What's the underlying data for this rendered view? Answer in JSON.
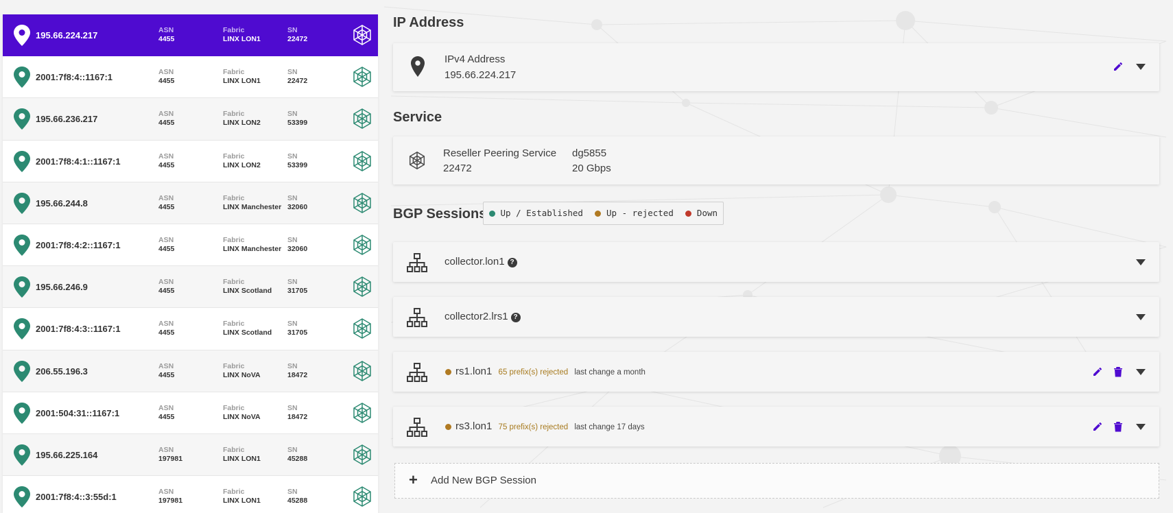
{
  "colors": {
    "accent": "#4f0bd0",
    "pin": "#2c8a72",
    "status_up": "#2c8a72",
    "status_rejected": "#b07a22",
    "status_down": "#c0392b",
    "action_purple": "#4f0bd0"
  },
  "connections": [
    {
      "ip": "195.66.224.217",
      "asn_label": "ASN",
      "asn": "4455",
      "fabric_label": "Fabric",
      "fabric": "LINX LON1",
      "sn_label": "SN",
      "sn": "22472",
      "active": true
    },
    {
      "ip": "2001:7f8:4::1167:1",
      "asn_label": "ASN",
      "asn": "4455",
      "fabric_label": "Fabric",
      "fabric": "LINX LON1",
      "sn_label": "SN",
      "sn": "22472"
    },
    {
      "ip": "195.66.236.217",
      "asn_label": "ASN",
      "asn": "4455",
      "fabric_label": "Fabric",
      "fabric": "LINX LON2",
      "sn_label": "SN",
      "sn": "53399"
    },
    {
      "ip": "2001:7f8:4:1::1167:1",
      "asn_label": "ASN",
      "asn": "4455",
      "fabric_label": "Fabric",
      "fabric": "LINX LON2",
      "sn_label": "SN",
      "sn": "53399"
    },
    {
      "ip": "195.66.244.8",
      "asn_label": "ASN",
      "asn": "4455",
      "fabric_label": "Fabric",
      "fabric": "LINX Manchester",
      "sn_label": "SN",
      "sn": "32060"
    },
    {
      "ip": "2001:7f8:4:2::1167:1",
      "asn_label": "ASN",
      "asn": "4455",
      "fabric_label": "Fabric",
      "fabric": "LINX Manchester",
      "sn_label": "SN",
      "sn": "32060"
    },
    {
      "ip": "195.66.246.9",
      "asn_label": "ASN",
      "asn": "4455",
      "fabric_label": "Fabric",
      "fabric": "LINX Scotland",
      "sn_label": "SN",
      "sn": "31705"
    },
    {
      "ip": "2001:7f8:4:3::1167:1",
      "asn_label": "ASN",
      "asn": "4455",
      "fabric_label": "Fabric",
      "fabric": "LINX Scotland",
      "sn_label": "SN",
      "sn": "31705"
    },
    {
      "ip": "206.55.196.3",
      "asn_label": "ASN",
      "asn": "4455",
      "fabric_label": "Fabric",
      "fabric": "LINX NoVA",
      "sn_label": "SN",
      "sn": "18472"
    },
    {
      "ip": "2001:504:31::1167:1",
      "asn_label": "ASN",
      "asn": "4455",
      "fabric_label": "Fabric",
      "fabric": "LINX NoVA",
      "sn_label": "SN",
      "sn": "18472"
    },
    {
      "ip": "195.66.225.164",
      "asn_label": "ASN",
      "asn": "197981",
      "fabric_label": "Fabric",
      "fabric": "LINX LON1",
      "sn_label": "SN",
      "sn": "45288"
    },
    {
      "ip": "2001:7f8:4::3:55d:1",
      "asn_label": "ASN",
      "asn": "197981",
      "fabric_label": "Fabric",
      "fabric": "LINX LON1",
      "sn_label": "SN",
      "sn": "45288"
    }
  ],
  "ip_section": {
    "title": "IP Address",
    "label": "IPv4 Address",
    "value": "195.66.224.217"
  },
  "service_section": {
    "title": "Service",
    "name": "Reseller Peering Service",
    "sn": "22472",
    "code": "dg5855",
    "speed": "20 Gbps"
  },
  "bgp_section": {
    "title": "BGP Sessions",
    "legend": [
      {
        "label": "Up / Established",
        "color": "#2c8a72"
      },
      {
        "label": "Up - rejected",
        "color": "#b07a22"
      },
      {
        "label": "Down",
        "color": "#c0392b"
      }
    ],
    "sessions": [
      {
        "name": "collector.lon1"
      },
      {
        "name": "collector2.lrs1"
      },
      {
        "name": "rs1.lon1",
        "rejected": "65 prefix(s) rejected",
        "last_change": "last change a month"
      },
      {
        "name": "rs3.lon1",
        "rejected": "75 prefix(s) rejected",
        "last_change": "last change 17 days"
      }
    ],
    "add_label": "Add New BGP Session"
  }
}
